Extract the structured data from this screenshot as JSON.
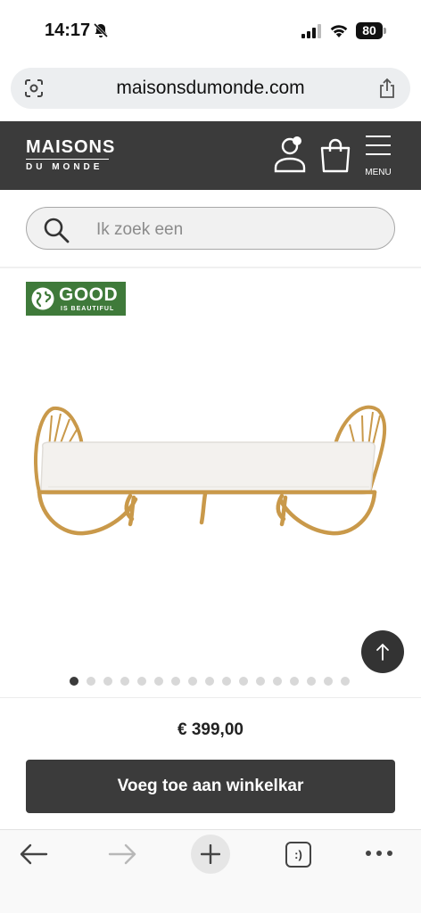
{
  "status_bar": {
    "time": "14:17",
    "battery": "80"
  },
  "browser": {
    "url": "maisonsdumonde.com",
    "tabs_label": ":)"
  },
  "header": {
    "logo_main": "MAISONS",
    "logo_sub": "DU MONDE",
    "menu_label": "MENU"
  },
  "search": {
    "placeholder": "Ik zoek een"
  },
  "product": {
    "badge_main": "GOOD",
    "badge_sub": "IS BEAUTIFUL",
    "image_count": 17,
    "active_image": 1,
    "price": "€ 399,00",
    "add_to_cart": "Voeg toe aan winkelkar"
  },
  "colors": {
    "header_bg": "#3b3b3b",
    "badge_green": "#3f7a3a",
    "button_bg": "#3b3b3b"
  },
  "icons": [
    "bell-muted-icon",
    "signal-icon",
    "wifi-icon",
    "scan-icon",
    "share-icon",
    "account-icon",
    "cart-icon",
    "menu-icon",
    "search-icon",
    "globe-icon",
    "arrow-up-icon",
    "back-icon",
    "forward-icon",
    "plus-icon",
    "tabs-icon",
    "more-icon"
  ]
}
